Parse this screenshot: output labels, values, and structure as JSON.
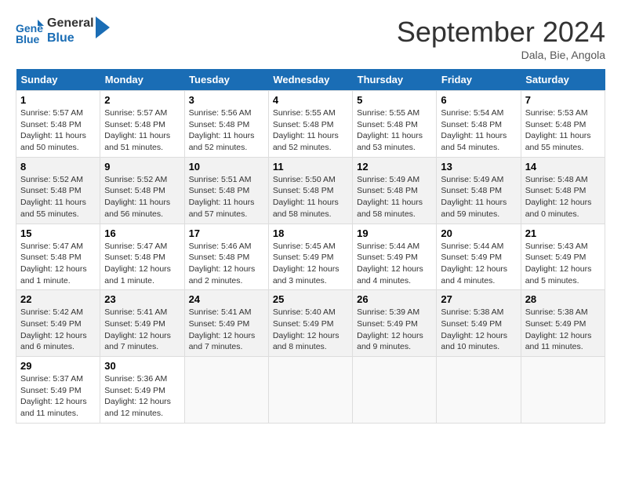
{
  "header": {
    "logo_line1": "General",
    "logo_line2": "Blue",
    "month": "September 2024",
    "location": "Dala, Bie, Angola"
  },
  "days_of_week": [
    "Sunday",
    "Monday",
    "Tuesday",
    "Wednesday",
    "Thursday",
    "Friday",
    "Saturday"
  ],
  "weeks": [
    [
      {
        "day": "1",
        "info": "Sunrise: 5:57 AM\nSunset: 5:48 PM\nDaylight: 11 hours\nand 50 minutes."
      },
      {
        "day": "2",
        "info": "Sunrise: 5:57 AM\nSunset: 5:48 PM\nDaylight: 11 hours\nand 51 minutes."
      },
      {
        "day": "3",
        "info": "Sunrise: 5:56 AM\nSunset: 5:48 PM\nDaylight: 11 hours\nand 52 minutes."
      },
      {
        "day": "4",
        "info": "Sunrise: 5:55 AM\nSunset: 5:48 PM\nDaylight: 11 hours\nand 52 minutes."
      },
      {
        "day": "5",
        "info": "Sunrise: 5:55 AM\nSunset: 5:48 PM\nDaylight: 11 hours\nand 53 minutes."
      },
      {
        "day": "6",
        "info": "Sunrise: 5:54 AM\nSunset: 5:48 PM\nDaylight: 11 hours\nand 54 minutes."
      },
      {
        "day": "7",
        "info": "Sunrise: 5:53 AM\nSunset: 5:48 PM\nDaylight: 11 hours\nand 55 minutes."
      }
    ],
    [
      {
        "day": "8",
        "info": "Sunrise: 5:52 AM\nSunset: 5:48 PM\nDaylight: 11 hours\nand 55 minutes."
      },
      {
        "day": "9",
        "info": "Sunrise: 5:52 AM\nSunset: 5:48 PM\nDaylight: 11 hours\nand 56 minutes."
      },
      {
        "day": "10",
        "info": "Sunrise: 5:51 AM\nSunset: 5:48 PM\nDaylight: 11 hours\nand 57 minutes."
      },
      {
        "day": "11",
        "info": "Sunrise: 5:50 AM\nSunset: 5:48 PM\nDaylight: 11 hours\nand 58 minutes."
      },
      {
        "day": "12",
        "info": "Sunrise: 5:49 AM\nSunset: 5:48 PM\nDaylight: 11 hours\nand 58 minutes."
      },
      {
        "day": "13",
        "info": "Sunrise: 5:49 AM\nSunset: 5:48 PM\nDaylight: 11 hours\nand 59 minutes."
      },
      {
        "day": "14",
        "info": "Sunrise: 5:48 AM\nSunset: 5:48 PM\nDaylight: 12 hours\nand 0 minutes."
      }
    ],
    [
      {
        "day": "15",
        "info": "Sunrise: 5:47 AM\nSunset: 5:48 PM\nDaylight: 12 hours\nand 1 minute."
      },
      {
        "day": "16",
        "info": "Sunrise: 5:47 AM\nSunset: 5:48 PM\nDaylight: 12 hours\nand 1 minute."
      },
      {
        "day": "17",
        "info": "Sunrise: 5:46 AM\nSunset: 5:48 PM\nDaylight: 12 hours\nand 2 minutes."
      },
      {
        "day": "18",
        "info": "Sunrise: 5:45 AM\nSunset: 5:49 PM\nDaylight: 12 hours\nand 3 minutes."
      },
      {
        "day": "19",
        "info": "Sunrise: 5:44 AM\nSunset: 5:49 PM\nDaylight: 12 hours\nand 4 minutes."
      },
      {
        "day": "20",
        "info": "Sunrise: 5:44 AM\nSunset: 5:49 PM\nDaylight: 12 hours\nand 4 minutes."
      },
      {
        "day": "21",
        "info": "Sunrise: 5:43 AM\nSunset: 5:49 PM\nDaylight: 12 hours\nand 5 minutes."
      }
    ],
    [
      {
        "day": "22",
        "info": "Sunrise: 5:42 AM\nSunset: 5:49 PM\nDaylight: 12 hours\nand 6 minutes."
      },
      {
        "day": "23",
        "info": "Sunrise: 5:41 AM\nSunset: 5:49 PM\nDaylight: 12 hours\nand 7 minutes."
      },
      {
        "day": "24",
        "info": "Sunrise: 5:41 AM\nSunset: 5:49 PM\nDaylight: 12 hours\nand 7 minutes."
      },
      {
        "day": "25",
        "info": "Sunrise: 5:40 AM\nSunset: 5:49 PM\nDaylight: 12 hours\nand 8 minutes."
      },
      {
        "day": "26",
        "info": "Sunrise: 5:39 AM\nSunset: 5:49 PM\nDaylight: 12 hours\nand 9 minutes."
      },
      {
        "day": "27",
        "info": "Sunrise: 5:38 AM\nSunset: 5:49 PM\nDaylight: 12 hours\nand 10 minutes."
      },
      {
        "day": "28",
        "info": "Sunrise: 5:38 AM\nSunset: 5:49 PM\nDaylight: 12 hours\nand 11 minutes."
      }
    ],
    [
      {
        "day": "29",
        "info": "Sunrise: 5:37 AM\nSunset: 5:49 PM\nDaylight: 12 hours\nand 11 minutes."
      },
      {
        "day": "30",
        "info": "Sunrise: 5:36 AM\nSunset: 5:49 PM\nDaylight: 12 hours\nand 12 minutes."
      },
      {
        "day": "",
        "info": ""
      },
      {
        "day": "",
        "info": ""
      },
      {
        "day": "",
        "info": ""
      },
      {
        "day": "",
        "info": ""
      },
      {
        "day": "",
        "info": ""
      }
    ]
  ]
}
